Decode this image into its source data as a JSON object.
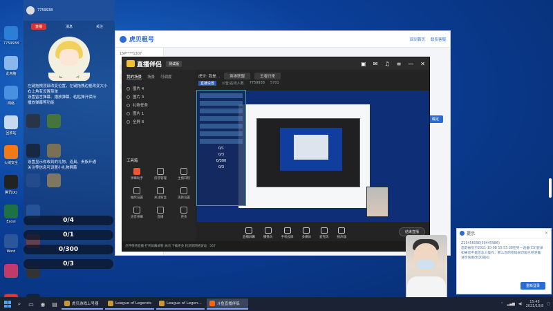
{
  "desktop": {
    "icons": [
      {
        "label": "7759938",
        "icon": "qq-icon",
        "color": "#2d7fd6"
      },
      {
        "label": "此电脑",
        "icon": "computer-icon",
        "color": "#8ab8ee"
      },
      {
        "label": "网络",
        "icon": "network-icon",
        "color": "#4a90e0"
      },
      {
        "label": "回收站",
        "icon": "recycle-bin-icon",
        "color": "#c5d9ef"
      },
      {
        "label": "火绒安全",
        "icon": "huorong-icon",
        "color": "#f07a18"
      },
      {
        "label": "腾讯QQ",
        "icon": "penguin-icon",
        "color": "#222222"
      },
      {
        "label": "Excel",
        "icon": "excel-icon",
        "color": "#1e7145"
      },
      {
        "label": "Word",
        "icon": "word-icon",
        "color": "#2b579a"
      },
      {
        "label": "",
        "icon": "game-icon",
        "color": "#c03a6a"
      },
      {
        "label": "",
        "icon": "folder-icon",
        "color": "#d33"
      }
    ],
    "icons2": [
      {
        "label": "",
        "icon": "chess-icon",
        "color": "#3b2a1a"
      },
      {
        "label": "",
        "icon": "nvidia-icon",
        "color": "#76b900"
      },
      {
        "label": "",
        "icon": "g-app-icon",
        "color": "#111"
      },
      {
        "label": "",
        "icon": "colorful-icon",
        "color": "#e9b13a"
      },
      {
        "label": "",
        "icon": "u-app-icon",
        "color": "#2d5fb0"
      },
      {
        "label": "",
        "icon": "sticky-icon",
        "color": "#f2c14e"
      }
    ],
    "icons3": [
      {
        "label": "",
        "icon": "shield-icon",
        "color": "#2d6fcf"
      },
      {
        "label": "",
        "icon": "skin-icon",
        "color": "#b9452d"
      },
      {
        "label": "",
        "icon": "dark-app-icon",
        "color": "#333"
      },
      {
        "label": "英雄联盟",
        "icon": "lol-icon",
        "color": "#10263e"
      }
    ]
  },
  "chat_panel": {
    "top_user": "7759938",
    "tabs": [
      "直播",
      "消息",
      "关注"
    ],
    "mascot_caption": "暂未入上榜",
    "note1": "左键拖拽顶部改变位置，左键拖拽边框改变大小\n右上角有设置菜单\n设置留言弹幕、播放弹幕、粘贴弹开保持\n播放弹幕等功能",
    "note2": "设置显示你收到的礼物、道具、贵族开通\n关注等信息可设置小礼物屏蔽"
  },
  "tasks": [
    {
      "label": "0/4",
      "progress": 0
    },
    {
      "label": "0/1",
      "progress": 0
    },
    {
      "label": "0/300",
      "progress": 0
    },
    {
      "label": "0/3",
      "progress": 0
    }
  ],
  "browser": {
    "logo": "虎贝租号",
    "right_links": [
      "回到首页",
      "联系客服"
    ],
    "side_text": "15P****1307",
    "blue_button": "确定"
  },
  "stream_app": {
    "title": "直播伴侣",
    "version_tag": "测试版",
    "tabs": [
      "我的场景",
      "场景",
      "可调度"
    ],
    "scenes": [
      "图片 4",
      "图片 3",
      "礼物任务",
      "图片 1",
      "全屏 8"
    ],
    "tools_title": "工具箱",
    "tools": [
      {
        "label": "弹幕助手",
        "red": true
      },
      {
        "label": "房管管理",
        "red": false
      },
      {
        "label": "主播日程",
        "red": false
      },
      {
        "label": "抽奖设置",
        "red": false
      },
      {
        "label": "关注粉丝",
        "red": false
      },
      {
        "label": "美颜设置",
        "red": false
      },
      {
        "label": "语音弹幕",
        "red": false
      },
      {
        "label": "直播",
        "red": false
      },
      {
        "label": "更多",
        "red": false
      }
    ],
    "info_label1": "虎牙: 我是…",
    "info_field1": "英雄联盟",
    "info_field2": "王者归来",
    "info_row2_chip": "直播设置",
    "info_row2_text": "公告/在线人数",
    "info_row2_id": "7759938",
    "info_row2_count": "5701",
    "bottom_tools": [
      "直播屏幕",
      "摄像头",
      "手机投屏",
      "多媒体",
      "麦克风",
      "扬声器"
    ],
    "live_button": "结束直播",
    "status": "点开保持直播 打开屏幕录制  关闭 下载更多 检测到网络波动",
    "status_count": "567"
  },
  "mini_overlay": {
    "labels": [
      "0/1",
      "0/3",
      "0/300",
      "0/3"
    ]
  },
  "notification": {
    "title": "提示",
    "body": "Z15456090(50445986)\n您的帐号于2021-10-08 15:53:38在另一设备(CS)登录\n如果您不是您本人操作，那么您的密码很可能已经泄露\n请尽快更改QQ密码",
    "ok": "重新登录"
  },
  "taskbar": {
    "apps": [
      {
        "label": "虎贝游戏上号器",
        "active": false
      },
      {
        "label": "League of Legends",
        "active": false
      },
      {
        "label": "League of Legen...",
        "active": false
      },
      {
        "label": "斗鱼直播伴侣",
        "active": true
      }
    ],
    "time": "15:48",
    "date": "2021/10/8"
  }
}
